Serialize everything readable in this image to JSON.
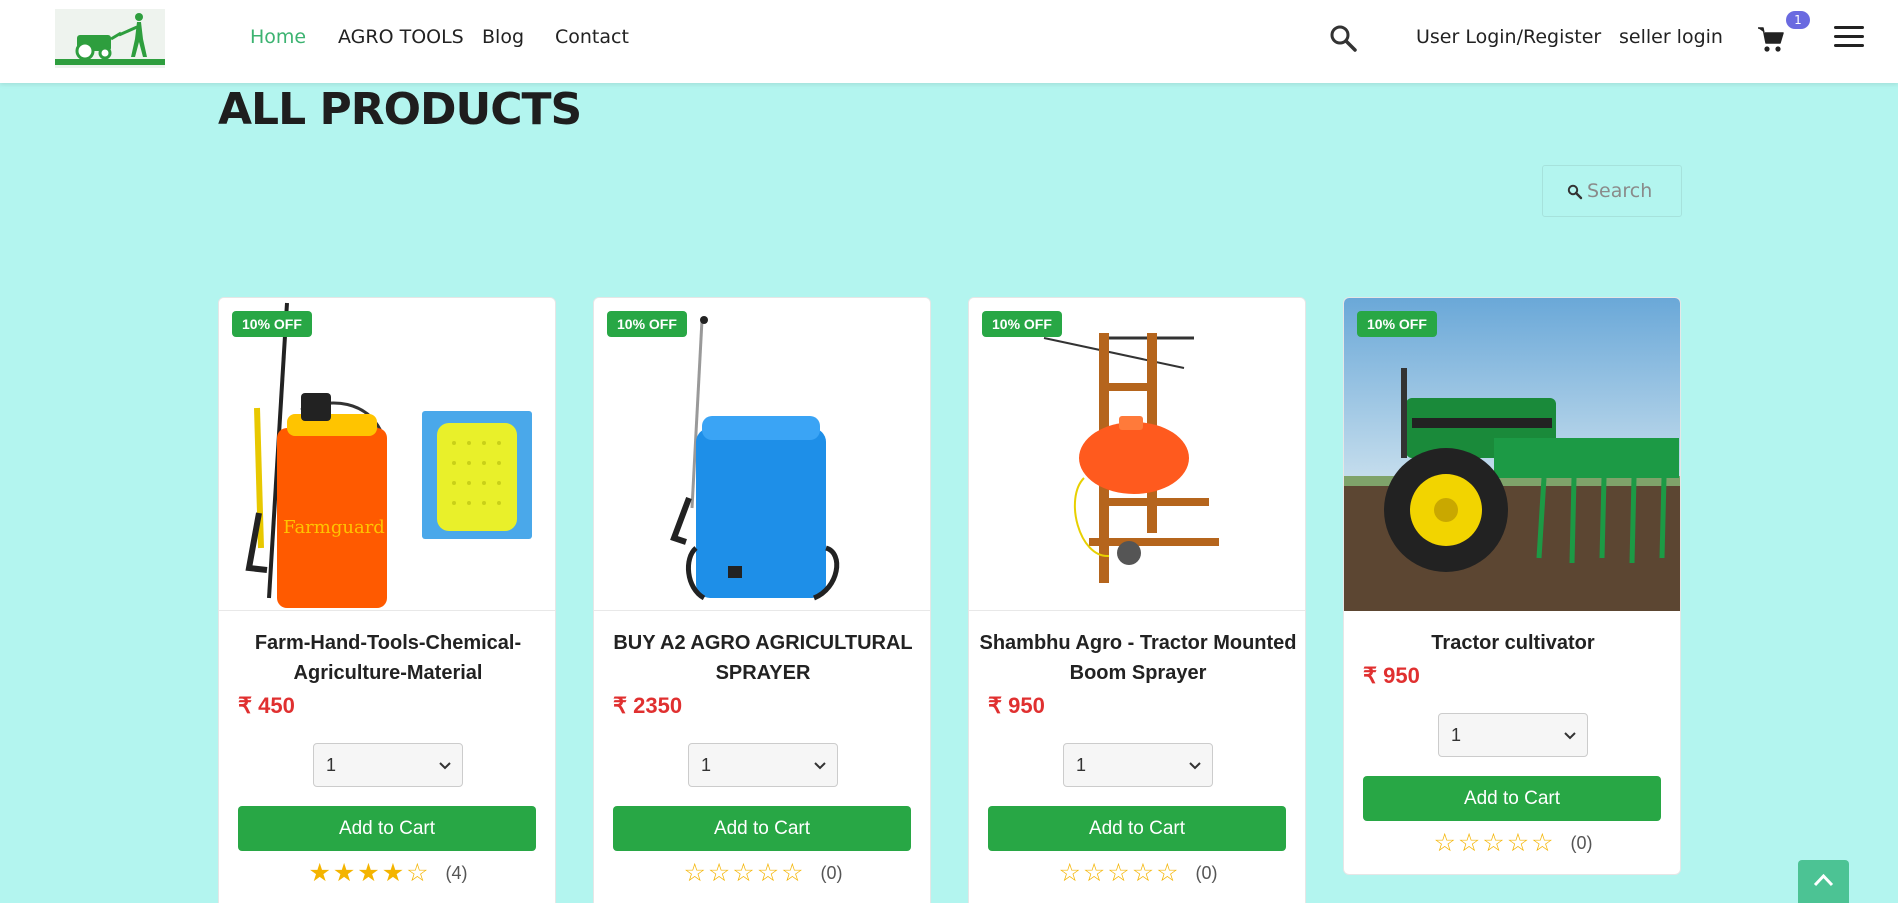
{
  "nav": {
    "home": "Home",
    "agro_tools": "AGRO TOOLS",
    "blog": "Blog",
    "contact": "Contact",
    "user_login": "User Login/Register",
    "seller_login": "seller login",
    "cart_count": "1"
  },
  "page": {
    "title": "ALL PRODUCTS",
    "search_placeholder": "Search"
  },
  "products": [
    {
      "discount": "10% OFF",
      "title": "Farm-Hand-Tools-Chemical-Agriculture-Material",
      "price": "₹ 450",
      "qty": "1",
      "add_label": "Add to Cart",
      "rating": 4,
      "stars": "★★★★☆",
      "rating_count": "(4)"
    },
    {
      "discount": "10% OFF",
      "title": "BUY A2 AGRO AGRICULTURAL SPRAYER",
      "price": "₹ 2350",
      "qty": "1",
      "add_label": "Add to Cart",
      "rating": 0,
      "stars": "☆☆☆☆☆",
      "rating_count": "(0)"
    },
    {
      "discount": "10% OFF",
      "title": "Shambhu Agro - Tractor Mounted Boom Sprayer",
      "price": "₹ 950",
      "qty": "1",
      "add_label": "Add to Cart",
      "rating": 0,
      "stars": "☆☆☆☆☆",
      "rating_count": "(0)"
    },
    {
      "discount": "10% OFF",
      "title": "Tractor cultivator",
      "price": "₹ 950",
      "qty": "1",
      "add_label": "Add to Cart",
      "rating": 0,
      "stars": "☆☆☆☆☆",
      "rating_count": "(0)"
    }
  ],
  "colors": {
    "background": "#b3f5ef",
    "accent": "#28a745",
    "price": "#e03030",
    "badge": "#6a6ae0"
  }
}
